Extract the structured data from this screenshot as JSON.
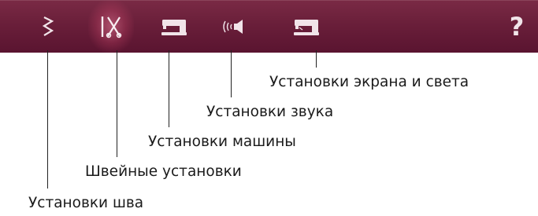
{
  "toolbar": {
    "tabs": [
      {
        "id": "stitch-settings",
        "icon": "zigzag-stitch-icon"
      },
      {
        "id": "sewing-settings",
        "icon": "needle-scissors-icon",
        "active": true
      },
      {
        "id": "machine-settings",
        "icon": "sewing-machine-icon"
      },
      {
        "id": "sound-settings",
        "icon": "speaker-sound-icon"
      },
      {
        "id": "screen-light-settings",
        "icon": "sewing-machine-light-icon"
      }
    ],
    "help_label": "?"
  },
  "callouts": {
    "stitch_settings": "Установки шва",
    "sewing_settings": "Швейные установки",
    "machine_settings": "Установки машины",
    "sound_settings": "Установки звука",
    "screen_light_settings": "Установки экрана и света"
  },
  "colors": {
    "toolbar_bg": "#6a1f3a",
    "icon": "#f1e4e9",
    "active_glow": "#ff8caa",
    "leader_line": "#222222",
    "label_text": "#1a1a1a"
  }
}
